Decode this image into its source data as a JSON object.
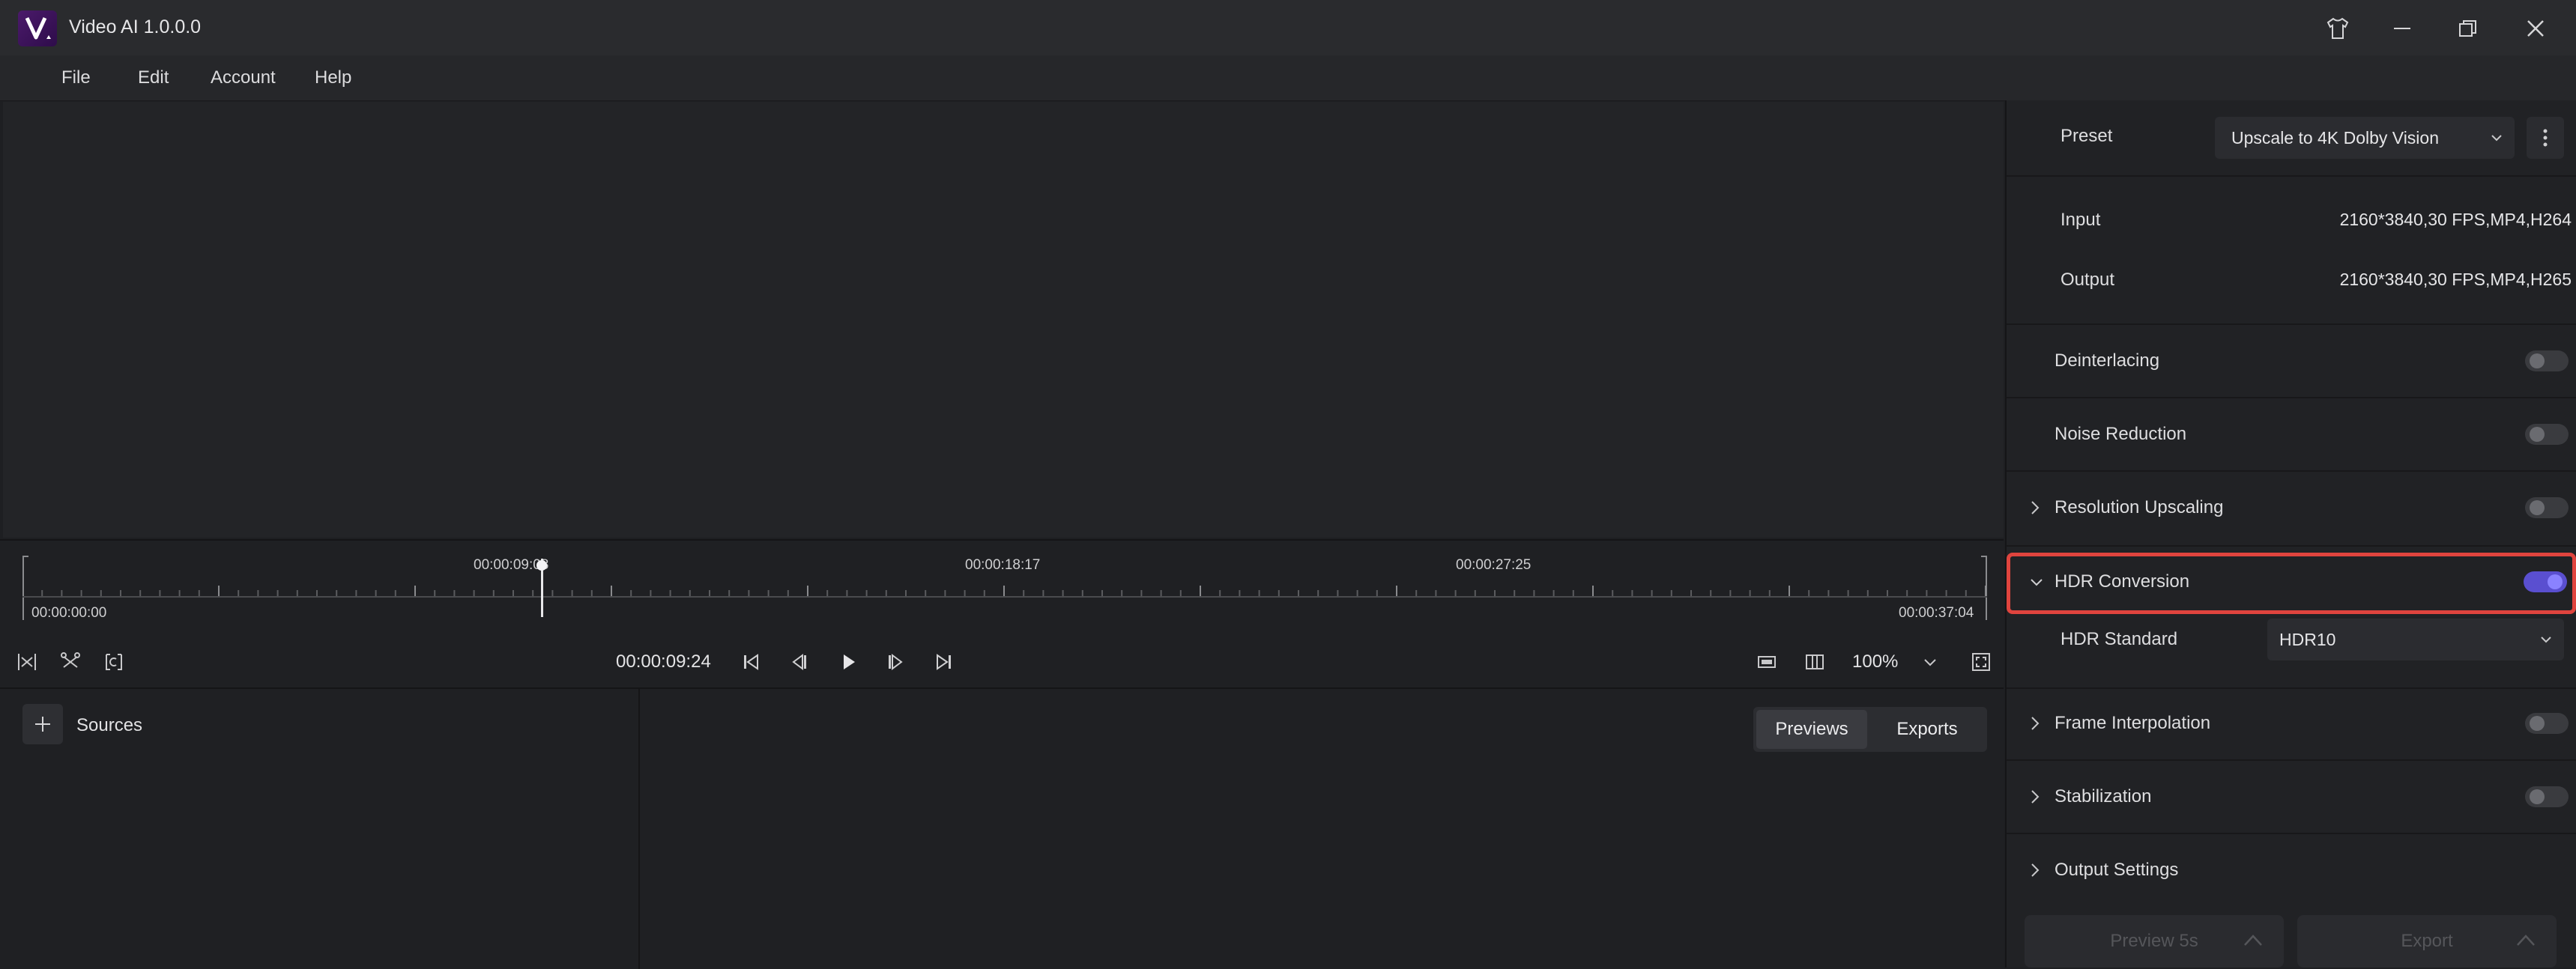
{
  "app": {
    "title": "Video AI 1.0.0.0",
    "logo_letter": "V"
  },
  "menu": {
    "items": [
      "File",
      "Edit",
      "Account",
      "Help"
    ]
  },
  "timeline": {
    "ticks": [
      "00:00:09:08",
      "00:00:18:17",
      "00:00:27:25"
    ],
    "start": "00:00:00:00",
    "end": "00:00:37:04",
    "current_time": "00:00:09:24",
    "zoom": "100%"
  },
  "sources": {
    "label": "Sources"
  },
  "tabs": {
    "previews": "Previews",
    "exports": "Exports",
    "active": "Previews"
  },
  "settings": {
    "preset_label": "Preset",
    "preset_value": "Upscale to 4K Dolby Vision",
    "input_label": "Input",
    "input_value": "2160*3840,30 FPS,MP4,H264",
    "output_label": "Output",
    "output_value": "2160*3840,30 FPS,MP4,H265",
    "deinterlacing": {
      "label": "Deinterlacing",
      "enabled": false
    },
    "noise_reduction": {
      "label": "Noise Reduction",
      "enabled": false
    },
    "resolution_upscaling": {
      "label": "Resolution Upscaling",
      "enabled": false
    },
    "hdr_conversion": {
      "label": "HDR Conversion",
      "enabled": true,
      "expanded": true
    },
    "hdr_standard_label": "HDR Standard",
    "hdr_standard_value": "HDR10",
    "frame_interpolation": {
      "label": "Frame Interpolation",
      "enabled": false
    },
    "stabilization": {
      "label": "Stabilization",
      "enabled": false
    },
    "output_settings": {
      "label": "Output Settings"
    }
  },
  "buttons": {
    "preview": "Preview 5s",
    "export": "Export"
  },
  "colors": {
    "accent": "#5a4fd0",
    "highlight": "#e0443e",
    "background": "#1e1f22"
  }
}
